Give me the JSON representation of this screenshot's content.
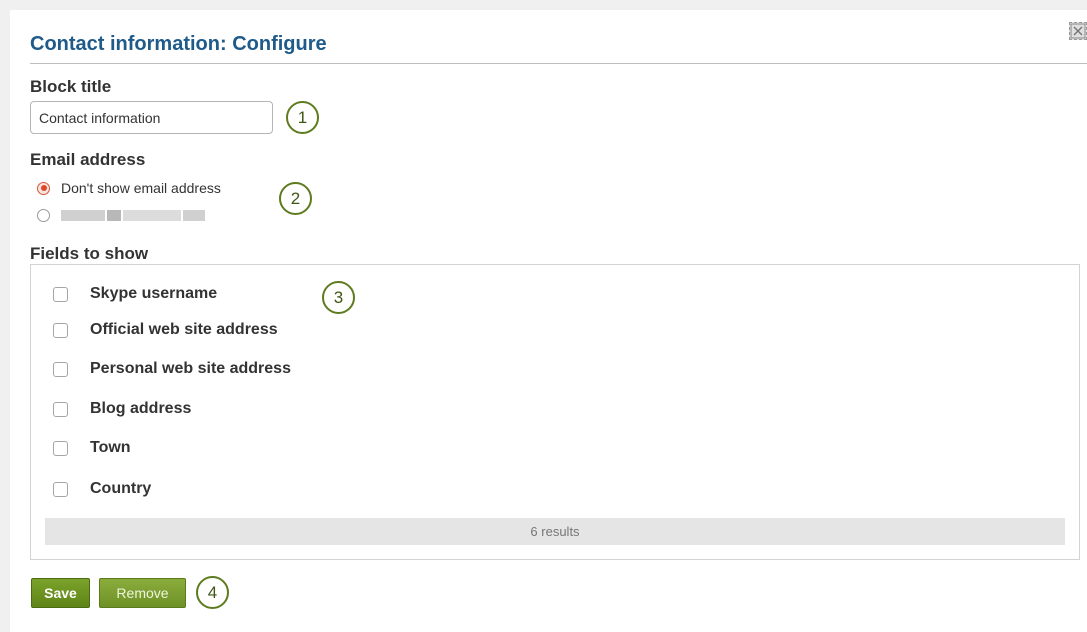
{
  "dialog": {
    "title": "Contact information: Configure"
  },
  "block_title": {
    "label": "Block title",
    "value": "Contact information",
    "callout": "1"
  },
  "email": {
    "label": "Email address",
    "options": [
      {
        "label": "Don't show email address",
        "checked": true
      },
      {
        "label": "",
        "checked": false,
        "redacted": true
      }
    ],
    "callout": "2"
  },
  "fields": {
    "label": "Fields to show",
    "callout": "3",
    "items": [
      {
        "label": "Skype username",
        "checked": false
      },
      {
        "label": "Official web site address",
        "checked": false
      },
      {
        "label": "Personal web site address",
        "checked": false
      },
      {
        "label": "Blog address",
        "checked": false
      },
      {
        "label": "Town",
        "checked": false
      },
      {
        "label": "Country",
        "checked": false
      }
    ],
    "results": "6 results"
  },
  "actions": {
    "save_label": "Save",
    "remove_label": "Remove",
    "callout": "4"
  },
  "colors": {
    "title": "#1e5a8a",
    "button_green": "#6b8f1f",
    "callout_green": "#5e7b1e",
    "radio_selected": "#dd4a2a"
  }
}
